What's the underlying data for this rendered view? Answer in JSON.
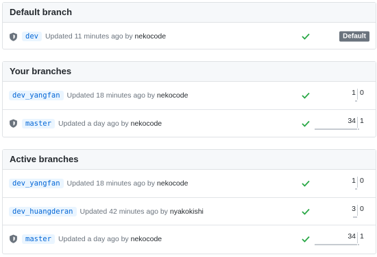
{
  "default_section": {
    "title": "Default branch",
    "rows": [
      {
        "branch": "dev",
        "updated": "Updated 11 minutes ago by",
        "user": "nekocode",
        "protected": true,
        "badge": "Default"
      }
    ]
  },
  "your_section": {
    "title": "Your branches",
    "rows": [
      {
        "branch": "dev_yangfan",
        "updated": "Updated 18 minutes ago by",
        "user": "nekocode",
        "protected": false,
        "behind": "1",
        "ahead": "0",
        "behind_frac": 0.03,
        "ahead_frac": 0.0
      },
      {
        "branch": "master",
        "updated": "Updated a day ago by",
        "user": "nekocode",
        "protected": true,
        "behind": "34",
        "ahead": "1",
        "behind_frac": 1.0,
        "ahead_frac": 0.03
      }
    ]
  },
  "active_section": {
    "title": "Active branches",
    "rows": [
      {
        "branch": "dev_yangfan",
        "updated": "Updated 18 minutes ago by",
        "user": "nekocode",
        "protected": false,
        "behind": "1",
        "ahead": "0",
        "behind_frac": 0.03,
        "ahead_frac": 0.0
      },
      {
        "branch": "dev_huangderan",
        "updated": "Updated 42 minutes ago by",
        "user": "nyakokishi",
        "protected": false,
        "behind": "3",
        "ahead": "0",
        "behind_frac": 0.09,
        "ahead_frac": 0.0
      },
      {
        "branch": "master",
        "updated": "Updated a day ago by",
        "user": "nekocode",
        "protected": true,
        "behind": "34",
        "ahead": "1",
        "behind_frac": 1.0,
        "ahead_frac": 0.03
      }
    ]
  },
  "colors": {
    "check": "#28a745",
    "branch_text": "#0366d6",
    "branch_bg": "#eaf5ff",
    "badge_bg": "#6a737d"
  },
  "icons": {
    "protected": "shield-icon",
    "status": "check-icon"
  }
}
